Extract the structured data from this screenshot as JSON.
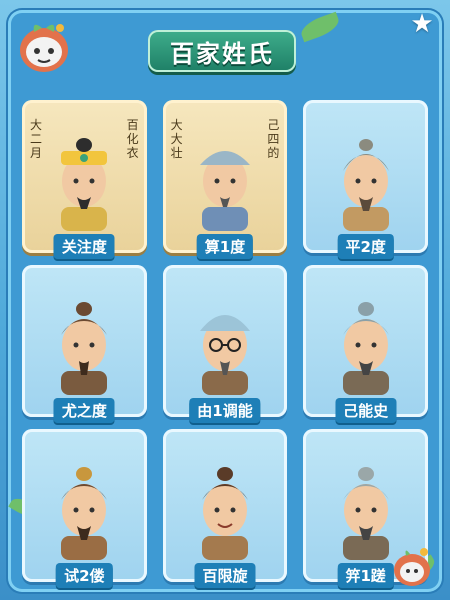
{
  "title": "百家姓氏",
  "scroll_text": {
    "left_column": [
      "大",
      "二",
      "月"
    ],
    "left_column_2": [
      "大",
      "大",
      "壮"
    ],
    "right_column": [
      "百",
      "化",
      "衣"
    ],
    "right_column_2": [
      "己",
      "四",
      "的"
    ]
  },
  "cards": [
    {
      "label": "关注度",
      "style": "scroll",
      "hair": "#2d2d2d",
      "cap": "#f2c53d"
    },
    {
      "label": "算1度",
      "style": "scroll",
      "hair": "#7b8a8f",
      "cap": "#9ab6c7"
    },
    {
      "label": "平2度",
      "style": "plain",
      "hair": "#8b8b7f",
      "cap": "none"
    },
    {
      "label": "尤之度",
      "style": "plain",
      "hair": "#6b4a32",
      "cap": "none"
    },
    {
      "label": "由1调能",
      "style": "plain",
      "hair": "#7f9db0",
      "cap": "#9cc4d8"
    },
    {
      "label": "己能史",
      "style": "plain",
      "hair": "#8aa0a8",
      "cap": "none"
    },
    {
      "label": "试2偻",
      "style": "plain",
      "hair": "#6b4a32",
      "cap": "none"
    },
    {
      "label": "百限旋",
      "style": "plain",
      "hair": "#5a3b28",
      "cap": "none"
    },
    {
      "label": "笄1蹉",
      "style": "plain",
      "hair": "#9aa7a8",
      "cap": "none"
    }
  ],
  "colors": {
    "background": "#4fa9da",
    "banner": "#1e7f66",
    "label_bg": "#1e7fb7"
  }
}
